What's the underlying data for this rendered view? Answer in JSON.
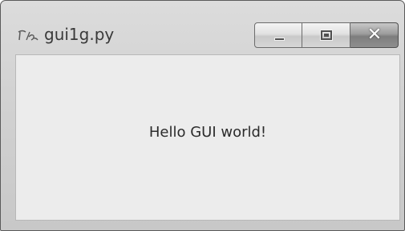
{
  "window": {
    "title": "gui1g.py",
    "icon": "tk-feather-icon"
  },
  "caption_buttons": {
    "minimize_icon": "minimize-icon",
    "maximize_icon": "maximize-icon",
    "close_glyph": "✕",
    "close_icon": "close-icon"
  },
  "content": {
    "label_text": "Hello GUI world!"
  },
  "colors": {
    "window_frame": "#d2d2d2",
    "client_background": "#ececec",
    "text": "#2b2b2b"
  }
}
